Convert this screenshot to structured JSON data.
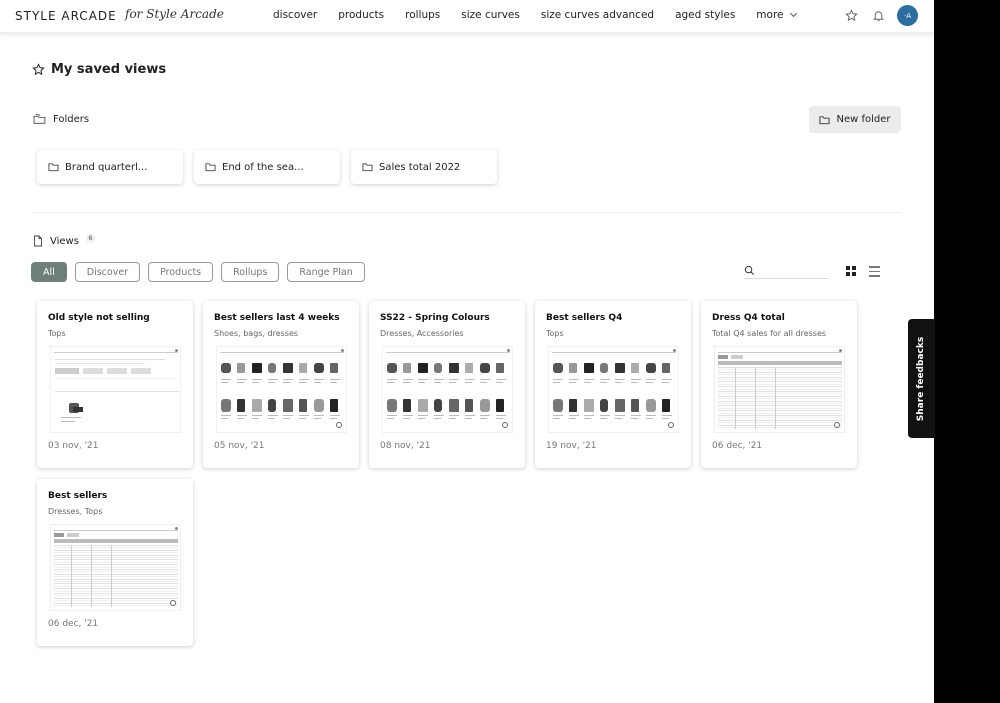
{
  "header": {
    "logo": "STYLE ARCADE",
    "logo_sub": "for Style Arcade",
    "nav": [
      "discover",
      "products",
      "rollups",
      "size curves",
      "size curves advanced",
      "aged styles"
    ],
    "more": "more",
    "avatar_initials": "·A"
  },
  "page": {
    "title": "My saved views",
    "folders_label": "Folders",
    "new_folder": "New folder",
    "views_label": "Views",
    "views_count": "6"
  },
  "folders": [
    "Brand quarterl...",
    "End of the sea...",
    "Sales total 2022"
  ],
  "filters": [
    "All",
    "Discover",
    "Products",
    "Rollups",
    "Range Plan"
  ],
  "active_filter": "All",
  "cards": [
    {
      "title": "Old style not selling",
      "subtitle": "Tops",
      "date": "03 nov, '21",
      "thumb": "discover"
    },
    {
      "title": "Best sellers last 4 weeks",
      "subtitle": "Shoes, bags, dresses",
      "date": "05 nov, '21",
      "thumb": "products"
    },
    {
      "title": "SS22 - Spring Colours",
      "subtitle": "Dresses, Accessories",
      "date": "08 nov, '21",
      "thumb": "products"
    },
    {
      "title": "Best sellers Q4",
      "subtitle": "Tops",
      "date": "19 nov, '21",
      "thumb": "products"
    },
    {
      "title": "Dress Q4 total",
      "subtitle": "Total Q4 sales for all dresses",
      "date": "06 dec, '21",
      "thumb": "table"
    },
    {
      "title": "Best sellers",
      "subtitle": "Dresses, Tops",
      "date": "06 dec, '21",
      "thumb": "table"
    }
  ],
  "feedback": "Share feedbacks",
  "colors": {
    "accent": "#2c6e9e",
    "active_chip": "#6e7f7a"
  }
}
